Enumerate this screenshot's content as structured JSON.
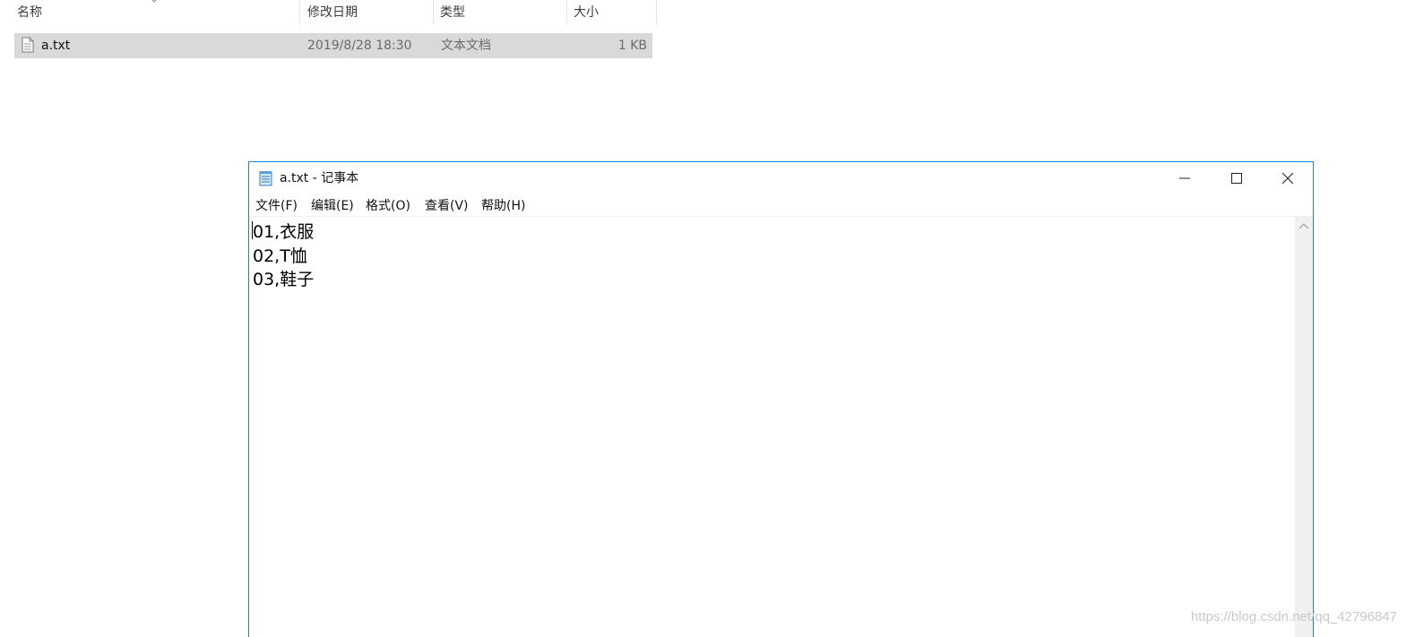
{
  "explorer": {
    "columns": [
      "名称",
      "修改日期",
      "类型",
      "大小"
    ],
    "file": {
      "name": "a.txt",
      "modified": "2019/8/28 18:30",
      "type": "文本文档",
      "size": "1 KB"
    }
  },
  "notepad": {
    "title": "a.txt - 记事本",
    "menu": [
      "文件(F)",
      "编辑(E)",
      "格式(O)",
      "查看(V)",
      "帮助(H)"
    ],
    "lines": [
      "01,衣服",
      "02,T恤",
      "03,鞋子"
    ]
  },
  "watermark": "https://blog.csdn.net/qq_42796847",
  "colors": {
    "window_border": "#1883d7",
    "selected_row": "#d9d9d9",
    "scrollbar": "#f0f0f0"
  },
  "icons": [
    "file-icon",
    "notepad-icon",
    "minimize-icon",
    "maximize-icon",
    "close-icon",
    "scroll-up-icon",
    "sort-caret-icon"
  ]
}
